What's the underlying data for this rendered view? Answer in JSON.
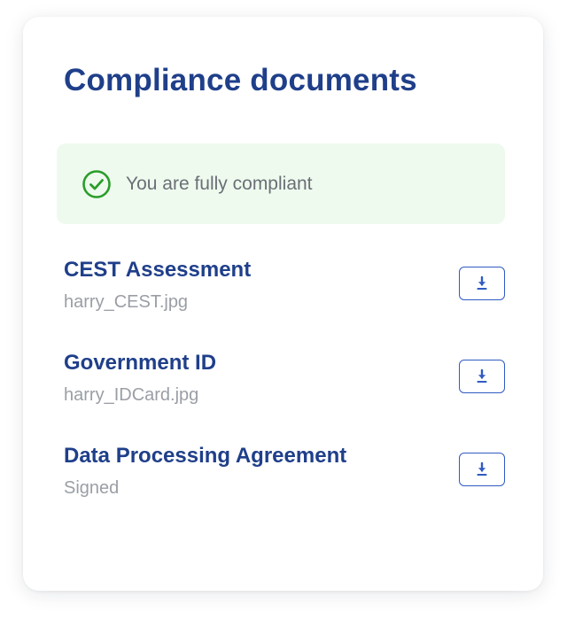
{
  "card": {
    "title": "Compliance documents"
  },
  "status": {
    "text": "You are fully compliant",
    "icon": "check-circle-icon",
    "color": "#2a9d2a",
    "background": "#eefaee"
  },
  "documents": [
    {
      "name": "CEST Assessment",
      "subtitle": "harry_CEST.jpg",
      "action_icon": "download-icon"
    },
    {
      "name": "Government ID",
      "subtitle": "harry_IDCard.jpg",
      "action_icon": "download-icon"
    },
    {
      "name": "Data Processing Agreement",
      "subtitle": "Signed",
      "action_icon": "download-icon"
    }
  ],
  "colors": {
    "heading": "#1f3f8a",
    "accent": "#2f5bc2",
    "muted": "#9a9ea5"
  }
}
